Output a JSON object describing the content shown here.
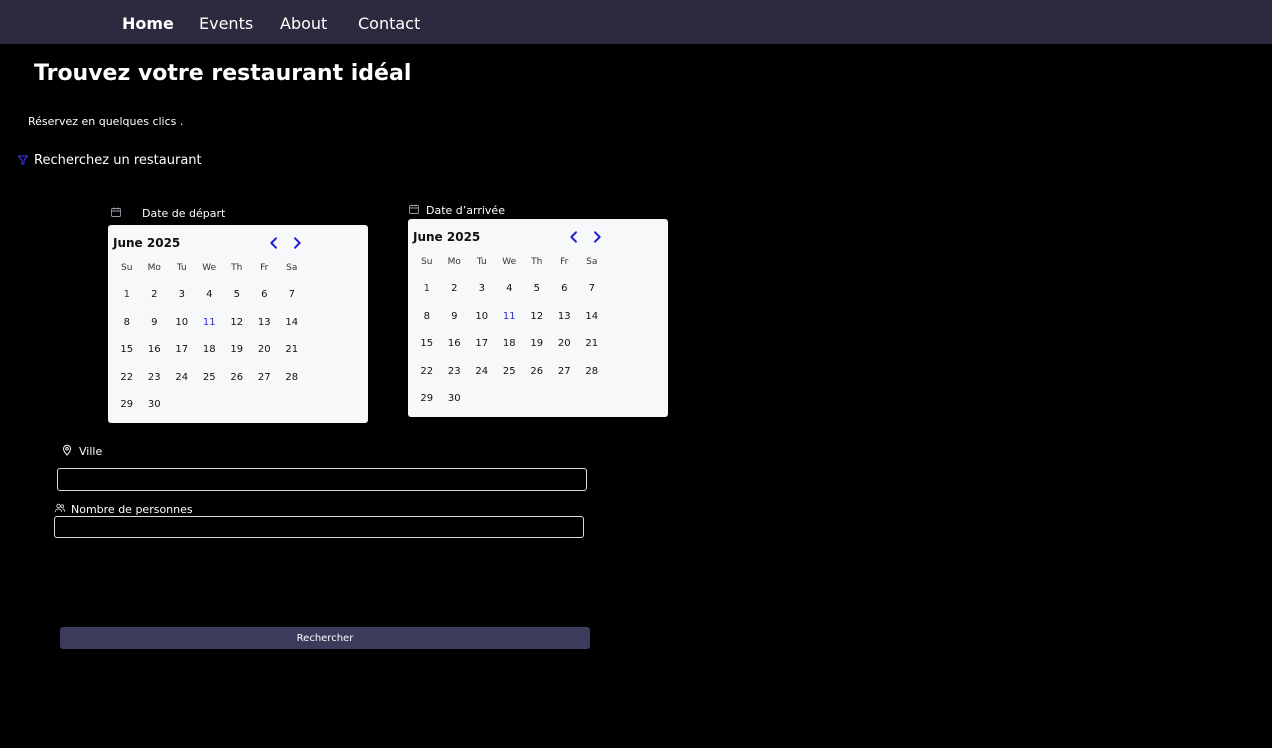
{
  "nav": {
    "items": [
      {
        "label": "Home"
      },
      {
        "label": "Events"
      },
      {
        "label": "About"
      },
      {
        "label": "Contact"
      }
    ]
  },
  "hero": {
    "title": "Trouvez votre restaurant idéal",
    "subtitle": "Réservez en quelques clics ."
  },
  "filter": {
    "label": "Recherchez un restaurant",
    "icon": "filter-icon"
  },
  "date_depart": {
    "label": "Date de départ",
    "icon": "calendar-icon",
    "calendar": {
      "month": "June 2025",
      "weekdays": [
        "Su",
        "Mo",
        "Tu",
        "We",
        "Th",
        "Fr",
        "Sa"
      ],
      "days": [
        "1",
        "2",
        "3",
        "4",
        "5",
        "6",
        "7",
        "8",
        "9",
        "10",
        "11",
        "12",
        "13",
        "14",
        "15",
        "16",
        "17",
        "18",
        "19",
        "20",
        "21",
        "22",
        "23",
        "24",
        "25",
        "26",
        "27",
        "28",
        "29",
        "30"
      ],
      "highlighted_day": "11"
    }
  },
  "date_arrivee": {
    "label": "Date d’arrivée",
    "icon": "calendar-icon",
    "calendar": {
      "month": "June 2025",
      "weekdays": [
        "Su",
        "Mo",
        "Tu",
        "We",
        "Th",
        "Fr",
        "Sa"
      ],
      "days": [
        "1",
        "2",
        "3",
        "4",
        "5",
        "6",
        "7",
        "8",
        "9",
        "10",
        "11",
        "12",
        "13",
        "14",
        "15",
        "16",
        "17",
        "18",
        "19",
        "20",
        "21",
        "22",
        "23",
        "24",
        "25",
        "26",
        "27",
        "28",
        "29",
        "30"
      ],
      "highlighted_day": "11"
    }
  },
  "ville": {
    "label": "Ville",
    "icon": "location-pin-icon",
    "value": "",
    "placeholder": ""
  },
  "personnes": {
    "label": "Nombre de personnes",
    "icon": "users-icon",
    "value": "",
    "placeholder": ""
  },
  "search_button": {
    "label": "Rechercher"
  },
  "colors": {
    "navbar_bg": "#2b2a3f",
    "page_bg": "#000000",
    "calendar_bg": "#f7f8fa",
    "accent": "#2f2fc9",
    "button_bg": "#3b3b5b"
  }
}
